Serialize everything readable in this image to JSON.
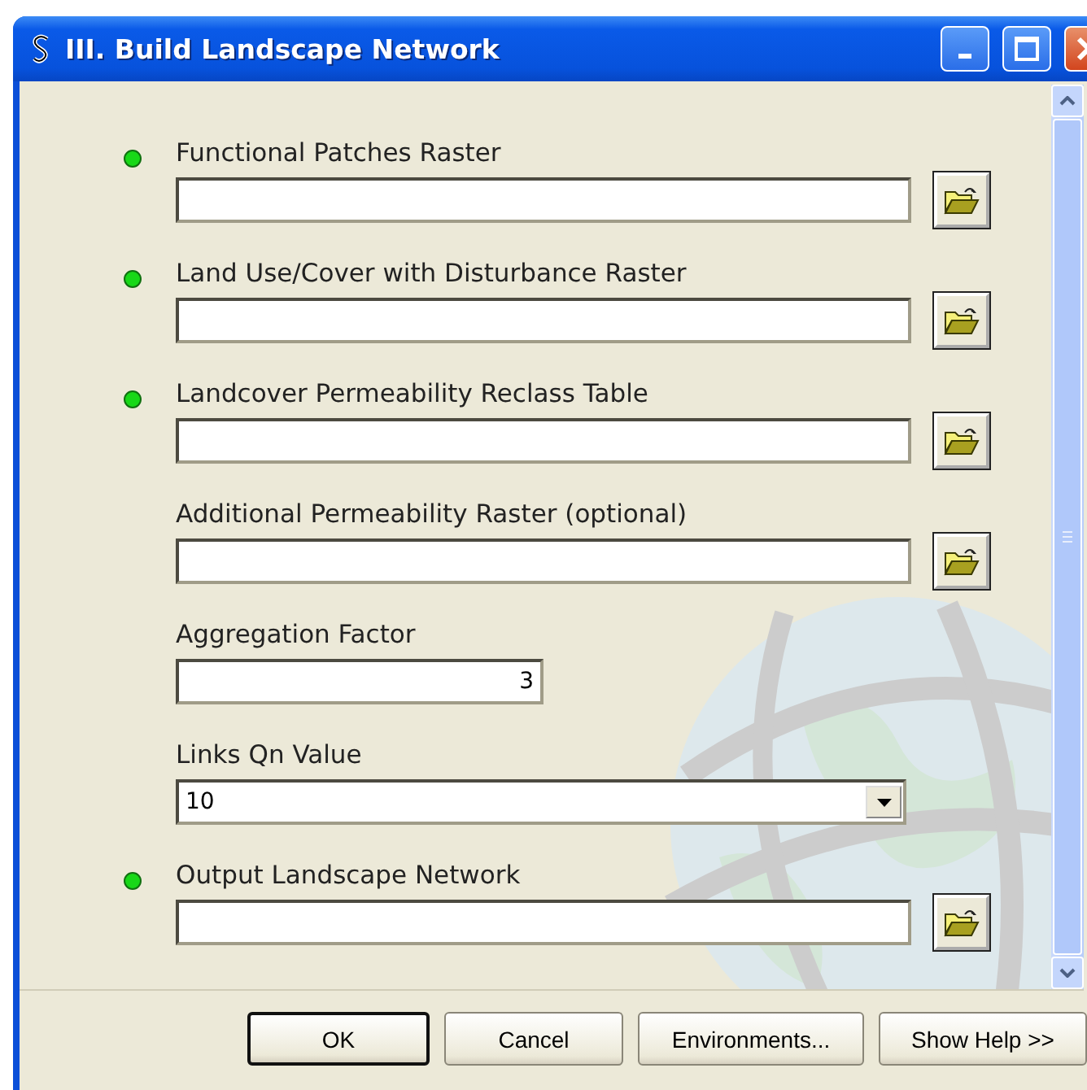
{
  "window": {
    "title": "III. Build Landscape Network"
  },
  "parameters": [
    {
      "label": "Functional Patches Raster",
      "required": true,
      "kind": "file"
    },
    {
      "label": "Land Use/Cover with Disturbance Raster",
      "required": true,
      "kind": "file"
    },
    {
      "label": "Landcover Permeability Reclass Table",
      "required": true,
      "kind": "file"
    },
    {
      "label": "Additional Permeability Raster (optional)",
      "required": false,
      "kind": "file"
    },
    {
      "label": "Aggregation Factor",
      "required": false,
      "kind": "number",
      "value": "3"
    },
    {
      "label": "Links Qn Value",
      "required": false,
      "kind": "dropdown",
      "value": "10"
    },
    {
      "label": "Output Landscape Network",
      "required": true,
      "kind": "file"
    }
  ],
  "buttons": [
    {
      "label": "OK",
      "default": true
    },
    {
      "label": "Cancel",
      "default": false
    },
    {
      "label": "Environments...",
      "default": false
    },
    {
      "label": "Show Help >>",
      "default": false
    }
  ]
}
